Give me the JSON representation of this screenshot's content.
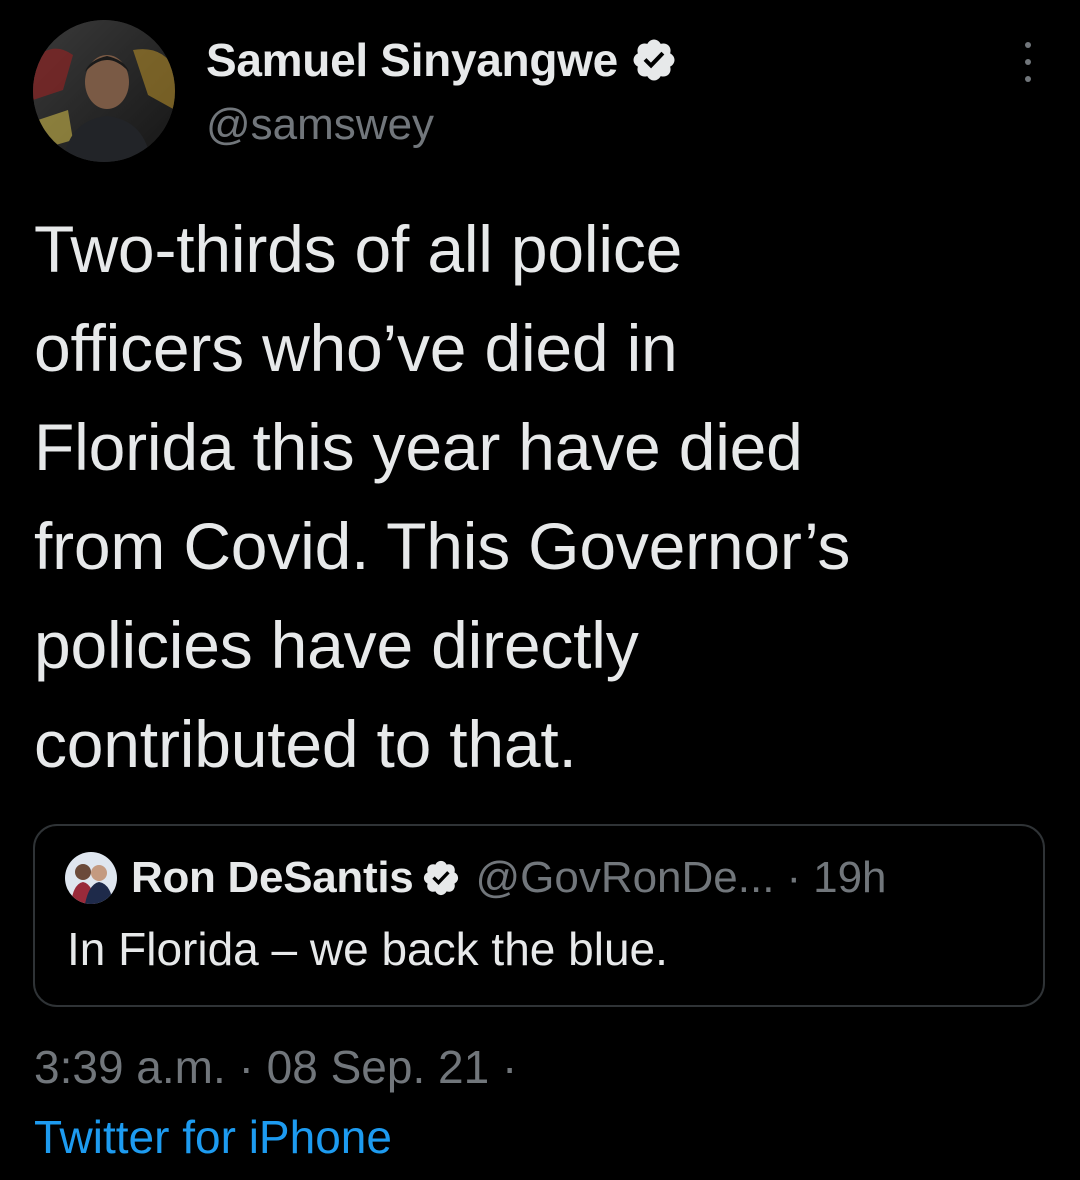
{
  "author": {
    "name": "Samuel Sinyangwe",
    "handle": "@samswey",
    "verified": true,
    "avatar_icon": "profile-photo"
  },
  "tweet": {
    "text": "Two-thirds of all police\nofficers who’ve died in\nFlorida this year have died\nfrom Covid. This Governor’s\npolicies have directly\ncontributed to that."
  },
  "quoted_tweet": {
    "name": "Ron DeSantis",
    "handle": "@GovRonDe...",
    "separator": "·",
    "time": "19h",
    "text": "In Florida – we back the blue.",
    "verified": true,
    "avatar_icon": "profile-photo"
  },
  "meta": {
    "time": "3:39 a.m.",
    "separator": "·",
    "date": "08 Sep. 21",
    "trailing_separator": "·",
    "source": "Twitter for iPhone"
  },
  "colors": {
    "background": "#000000",
    "text": "#e7e9ea",
    "muted": "#71767b",
    "link": "#1d9bf0",
    "border": "#2f3336"
  },
  "icons": {
    "verified": "verified-badge-icon",
    "more": "more-vertical-icon"
  }
}
